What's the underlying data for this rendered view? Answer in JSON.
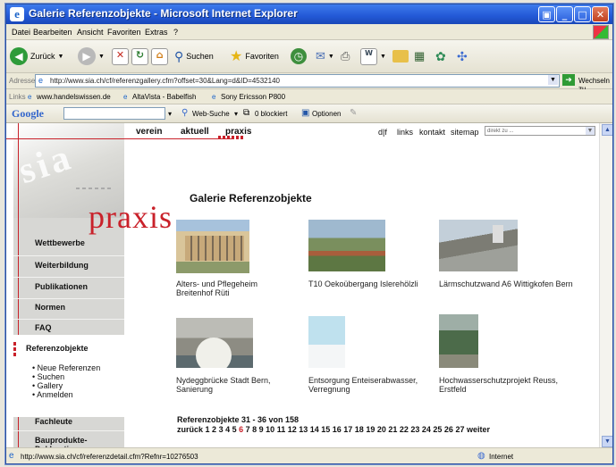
{
  "window": {
    "title": "Galerie Referenzobjekte - Microsoft Internet Explorer"
  },
  "menu": [
    "Datei",
    "Bearbeiten",
    "Ansicht",
    "Favoriten",
    "Extras",
    "?"
  ],
  "toolbar": {
    "back": "Zurück",
    "search": "Suchen",
    "favorites": "Favoriten"
  },
  "address": {
    "label": "Adresse",
    "url": "http://www.sia.ch/cf/referenzgallery.cfm?offset=30&Lang=d&ID=4532140",
    "go": "Wechseln zu"
  },
  "links_bar": {
    "label": "Links",
    "items": [
      "www.handelswissen.de",
      "AltaVista - Babelfish",
      "Sony Ericsson P800"
    ]
  },
  "google_bar": {
    "logo": "Google",
    "web_search": "Web-Suche",
    "blocked": "0 blockiert",
    "options": "Optionen"
  },
  "site": {
    "top_nav": [
      "verein",
      "aktuell",
      "praxis"
    ],
    "util_nav": [
      "d|f",
      "links",
      "kontakt",
      "sitemap"
    ],
    "direkt_placeholder": "direkt zu ...",
    "brand_word": "praxis",
    "logo_text": "sia",
    "side_nav": [
      "Wettbewerbe",
      "Weiterbildung",
      "Publikationen",
      "Normen",
      "FAQ"
    ],
    "active_section": "Referenzobjekte",
    "sub_nav": [
      "• Neue Referenzen",
      "• Suchen",
      "• Gallery",
      "• Anmelden"
    ],
    "bottom_nav": [
      "Fachleute",
      "Bauprodukte-Deklaration"
    ]
  },
  "gallery": {
    "title": "Galerie Referenzobjekte",
    "items": [
      {
        "caption": "Alters- und Pflegeheim Breitenhof Rüti"
      },
      {
        "caption": "T10 Oekoübergang Islerehölzli"
      },
      {
        "caption": "Lärmschutzwand A6 Wittigkofen Bern"
      },
      {
        "caption": "Nydeggbrücke Stadt Bern, Sanierung"
      },
      {
        "caption": "Entsorgung Enteiserabwasser, Verregnung"
      },
      {
        "caption": "Hochwasserschutzprojekt Reuss, Erstfeld"
      }
    ],
    "range_text": "Referenzobjekte 31 - 36 von 158",
    "prev": "zurück",
    "pages": [
      "1",
      "2",
      "3",
      "4",
      "5",
      "6",
      "7",
      "8",
      "9",
      "10",
      "11",
      "12",
      "13",
      "14",
      "15",
      "16",
      "17",
      "18",
      "19",
      "20",
      "21",
      "22",
      "23",
      "24",
      "25",
      "26",
      "27"
    ],
    "current_page": "6",
    "next": "weiter"
  },
  "status": {
    "text": "http://www.sia.ch/cf/referenzdetail.cfm?Refnr=10276503",
    "zone": "Internet"
  }
}
